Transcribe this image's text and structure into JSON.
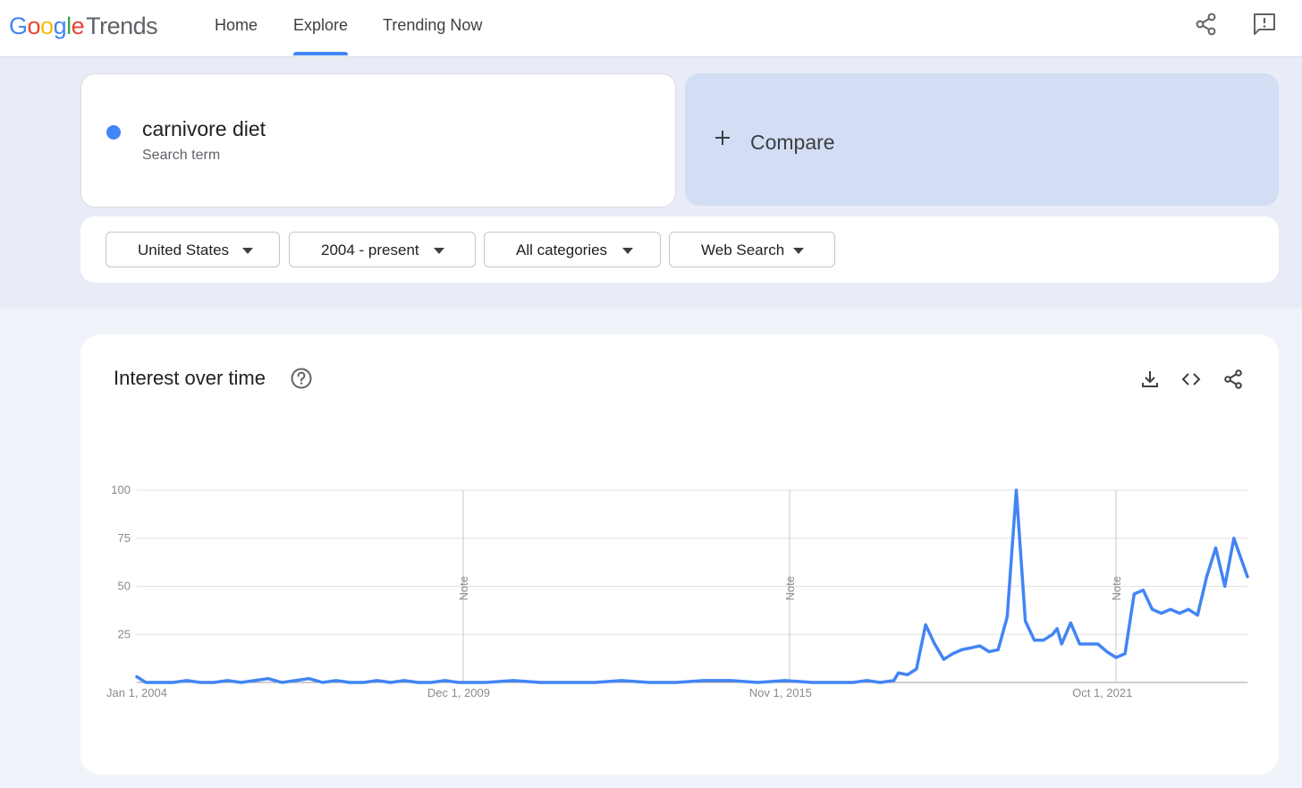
{
  "header": {
    "logo": {
      "google": "Google",
      "trends": "Trends"
    },
    "tabs": [
      {
        "label": "Home",
        "active": false
      },
      {
        "label": "Explore",
        "active": true
      },
      {
        "label": "Trending Now",
        "active": false
      }
    ],
    "icons": [
      "share-icon",
      "feedback-icon"
    ]
  },
  "search_term": {
    "name": "carnivore diet",
    "subtitle": "Search term",
    "color": "#4285f4"
  },
  "compare": {
    "label": "Compare"
  },
  "filters": [
    {
      "label": "United States"
    },
    {
      "label": "2004 - present"
    },
    {
      "label": "All categories"
    },
    {
      "label": "Web Search"
    }
  ],
  "interest_panel": {
    "title": "Interest over time",
    "icons": [
      "help-icon",
      "download-icon",
      "embed-icon",
      "share-icon"
    ]
  },
  "chart_data": {
    "type": "line",
    "title": "",
    "xlabel": "",
    "ylabel": "",
    "ylim": [
      0,
      100
    ],
    "yticks": [
      100,
      75,
      50,
      25
    ],
    "x_tick_labels": [
      "Jan 1, 2004",
      "Dec 1, 2009",
      "Nov 1, 2015",
      "Oct 1, 2021"
    ],
    "x_range": [
      "2004-01",
      "2024-06"
    ],
    "notes": [
      {
        "x": "2010-01",
        "label": "Note"
      },
      {
        "x": "2016-01",
        "label": "Note"
      },
      {
        "x": "2022-01",
        "label": "Note"
      }
    ],
    "grid": true,
    "color": "#4285f4",
    "series": [
      {
        "x": [
          "2004-01",
          "2004-03",
          "2004-06",
          "2004-09",
          "2004-12",
          "2005-03",
          "2005-06",
          "2005-09",
          "2005-12",
          "2006-03",
          "2006-06",
          "2006-09",
          "2006-12",
          "2007-03",
          "2007-06",
          "2007-09",
          "2007-12",
          "2008-03",
          "2008-06",
          "2008-09",
          "2008-12",
          "2009-03",
          "2009-06",
          "2009-09",
          "2009-12",
          "2010-06",
          "2010-12",
          "2011-06",
          "2011-12",
          "2012-06",
          "2012-12",
          "2013-06",
          "2013-12",
          "2014-06",
          "2014-12",
          "2015-06",
          "2015-12",
          "2016-06",
          "2016-12",
          "2017-03",
          "2017-06",
          "2017-09",
          "2017-12",
          "2018-01",
          "2018-03",
          "2018-05",
          "2018-07",
          "2018-09",
          "2018-11",
          "2019-01",
          "2019-03",
          "2019-05",
          "2019-07",
          "2019-09",
          "2019-11",
          "2020-01",
          "2020-03",
          "2020-05",
          "2020-07",
          "2020-09",
          "2020-11",
          "2020-12",
          "2021-01",
          "2021-03",
          "2021-05",
          "2021-07",
          "2021-09",
          "2021-11",
          "2022-01",
          "2022-03",
          "2022-05",
          "2022-07",
          "2022-09",
          "2022-11",
          "2023-01",
          "2023-03",
          "2023-05",
          "2023-07",
          "2023-09",
          "2023-11",
          "2024-01",
          "2024-03",
          "2024-06"
        ],
        "values": [
          3,
          0,
          0,
          0,
          1,
          0,
          0,
          1,
          0,
          1,
          2,
          0,
          1,
          2,
          0,
          1,
          0,
          0,
          1,
          0,
          1,
          0,
          0,
          1,
          0,
          0,
          1,
          0,
          0,
          0,
          1,
          0,
          0,
          1,
          1,
          0,
          1,
          0,
          0,
          0,
          1,
          0,
          1,
          5,
          4,
          7,
          30,
          20,
          12,
          15,
          17,
          18,
          19,
          16,
          17,
          34,
          100,
          32,
          22,
          22,
          25,
          28,
          20,
          31,
          20,
          20,
          20,
          16,
          13,
          15,
          46,
          48,
          38,
          36,
          38,
          36,
          38,
          35,
          55,
          70,
          50,
          75,
          55
        ]
      }
    ]
  }
}
